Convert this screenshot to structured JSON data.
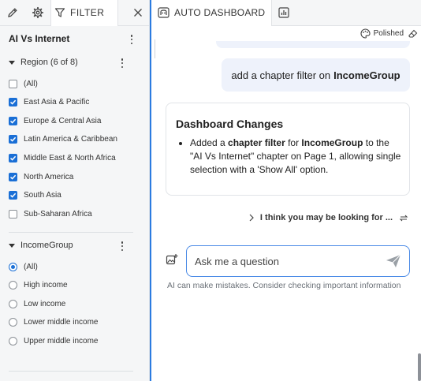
{
  "left_panel": {
    "filter_tab_label": "FILTER",
    "title": "AI Vs Internet",
    "region": {
      "heading": "Region (6 of 8)",
      "items": [
        {
          "label": "(All)",
          "checked": false
        },
        {
          "label": "East Asia & Pacific",
          "checked": true
        },
        {
          "label": "Europe & Central Asia",
          "checked": true
        },
        {
          "label": "Latin America & Caribbean",
          "checked": true
        },
        {
          "label": "Middle East & North Africa",
          "checked": true
        },
        {
          "label": "North America",
          "checked": true
        },
        {
          "label": "South Asia",
          "checked": true
        },
        {
          "label": "Sub-Saharan Africa",
          "checked": false
        }
      ]
    },
    "income": {
      "heading": "IncomeGroup",
      "items": [
        {
          "label": "(All)",
          "selected": true
        },
        {
          "label": "High income",
          "selected": false
        },
        {
          "label": "Low income",
          "selected": false
        },
        {
          "label": "Lower middle income",
          "selected": false
        },
        {
          "label": "Upper middle income",
          "selected": false
        }
      ]
    }
  },
  "right_panel": {
    "tab_label": "AUTO DASHBOARD",
    "style_label": "Polished",
    "user_message": {
      "prefix": "add a chapter filter on",
      "bold": "IncomeGroup"
    },
    "response_card": {
      "title": "Dashboard Changes",
      "bullet_parts": [
        "Added a ",
        "chapter filter",
        " for ",
        "IncomeGroup",
        " to the \"AI Vs Internet\" chapter on Page 1, allowing single selection with a 'Show All' option."
      ]
    },
    "suggestion": "I think you may be looking for ...",
    "ask_placeholder": "Ask me a question",
    "disclaimer": "AI can make mistakes. Consider checking important information"
  },
  "colors": {
    "accent": "#1a6fd6",
    "user_bubble": "#eef2fb",
    "panel_bg": "#f5f6f7"
  }
}
